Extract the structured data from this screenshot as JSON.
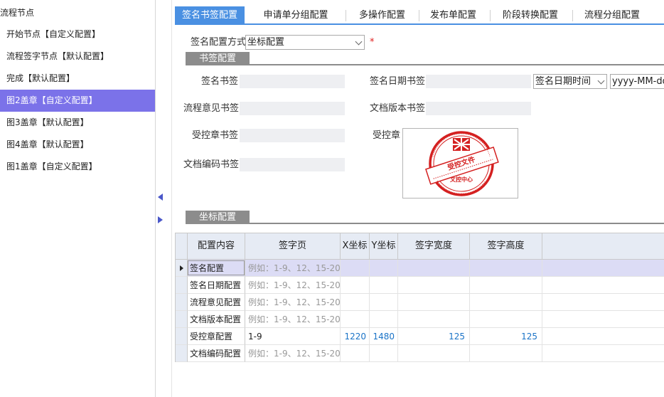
{
  "tree": {
    "root": "流程节点",
    "items": [
      {
        "label": "开始节点【自定义配置】",
        "selected": false
      },
      {
        "label": "流程签字节点【默认配置】",
        "selected": false
      },
      {
        "label": "完成【默认配置】",
        "selected": false
      },
      {
        "label": "图2盖章【自定义配置】",
        "selected": true
      },
      {
        "label": "图3盖章【默认配置】",
        "selected": false
      },
      {
        "label": "图4盖章【默认配置】",
        "selected": false
      },
      {
        "label": "图1盖章【自定义配置】",
        "selected": false
      }
    ]
  },
  "tabs": [
    "签名书签配置",
    "申请单分组配置",
    "多操作配置",
    "发布单配置",
    "阶段转换配置",
    "流程分组配置"
  ],
  "active_tab": 0,
  "form": {
    "method_label": "签名配置方式",
    "method_value": "坐标配置",
    "required_mark": "*",
    "bookmark_section": "书签配置",
    "fields": {
      "sign_bookmark": "签名书签",
      "sign_date_bookmark": "签名日期书签",
      "opinion_bookmark": "流程意见书签",
      "version_bookmark": "文档版本书签",
      "controlled_bookmark": "受控章书签",
      "controlled_stamp": "受控章",
      "code_bookmark": "文档编码书签"
    },
    "date_type_value": "签名日期时间",
    "date_format_value": "yyyy-MM-dd H",
    "coordinate_section": "坐标配置"
  },
  "stamp": {
    "main_text": "受控文件",
    "bottom_text": "文控中心",
    "color": "#d42020"
  },
  "grid": {
    "headers": [
      "配置内容",
      "签字页",
      "X坐标",
      "Y坐标",
      "签字宽度",
      "签字高度"
    ],
    "rows": [
      {
        "name": "签名配置",
        "page": "例如：1-9、12、15-20",
        "x": "",
        "y": "",
        "w": "",
        "h": "",
        "selected": true,
        "placeholder": true
      },
      {
        "name": "签名日期配置",
        "page": "例如：1-9、12、15-20",
        "x": "",
        "y": "",
        "w": "",
        "h": "",
        "selected": false,
        "placeholder": true
      },
      {
        "name": "流程意见配置",
        "page": "例如：1-9、12、15-20",
        "x": "",
        "y": "",
        "w": "",
        "h": "",
        "selected": false,
        "placeholder": true
      },
      {
        "name": "文档版本配置",
        "page": "例如：1-9、12、15-20",
        "x": "",
        "y": "",
        "w": "",
        "h": "",
        "selected": false,
        "placeholder": true
      },
      {
        "name": "受控章配置",
        "page": "1-9",
        "x": "1220",
        "y": "1480",
        "w": "125",
        "h": "125",
        "selected": false,
        "placeholder": false
      },
      {
        "name": "文档编码配置",
        "page": "例如：1-9、12、15-20",
        "x": "",
        "y": "",
        "w": "",
        "h": "",
        "selected": false,
        "placeholder": true
      }
    ]
  },
  "colors": {
    "accent": "#4a90e2",
    "selected_tree": "#7b72e9",
    "grid_header": "#e6ebf4",
    "selected_row": "#dcdcf5",
    "number": "#1a73c7"
  }
}
